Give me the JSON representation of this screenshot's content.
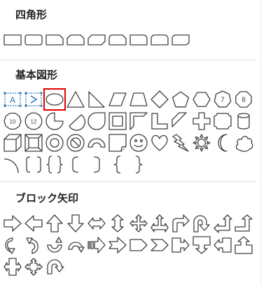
{
  "sections": [
    {
      "id": "rect",
      "title": "四角形",
      "shapes": [
        "rectangle",
        "rounded-rectangle",
        "snip-single-corner-rectangle",
        "snip-same-side-corner-rectangle",
        "snip-diagonal-corner-rectangle",
        "snip-round-single-corner-rectangle",
        "round-single-corner-rectangle",
        "round-same-side-corner-rectangle",
        "round-diagonal-corner-rectangle"
      ]
    },
    {
      "id": "basic",
      "title": "基本図形",
      "shapes": [
        "text-box",
        "vertical-text-box",
        "oval",
        "isosceles-triangle",
        "right-triangle",
        "parallelogram",
        "trapezoid",
        "diamond",
        "pentagon",
        "hexagon",
        "heptagon",
        "octagon",
        "decagon",
        "dodecagon",
        "pie",
        "chord",
        "teardrop",
        "frame",
        "half-frame",
        "l-shape",
        "diagonal-stripe",
        "cross",
        "plaque",
        "can",
        "cube",
        "bevel",
        "donut",
        "no-symbol",
        "block-arc",
        "folded-corner",
        "smiley-face",
        "heart",
        "lightning-bolt",
        "sun",
        "moon",
        "cloud",
        "arc",
        "double-bracket",
        "double-brace",
        "left-bracket",
        "right-bracket",
        "left-brace",
        "right-brace"
      ],
      "labels": {
        "text-box": "A",
        "vertical-text-box": "A",
        "heptagon": "7",
        "octagon": "8",
        "decagon": "10",
        "dodecagon": "12"
      },
      "selected": "oval"
    },
    {
      "id": "arrows",
      "title": "ブロック矢印",
      "shapes": [
        "right-arrow",
        "left-arrow",
        "up-arrow",
        "down-arrow",
        "left-right-arrow",
        "up-down-arrow",
        "quad-arrow",
        "left-right-up-arrow",
        "bent-arrow",
        "u-turn-arrow",
        "left-up-arrow",
        "bent-up-arrow",
        "curved-right-arrow",
        "curved-left-arrow",
        "curved-up-arrow",
        "curved-down-arrow",
        "striped-right-arrow",
        "notched-right-arrow",
        "pentagon-arrow",
        "chevron",
        "right-arrow-callout",
        "down-arrow-callout",
        "left-arrow-callout",
        "up-arrow-callout",
        "left-right-arrow-callout",
        "quad-arrow-callout",
        "circular-arrow"
      ]
    }
  ],
  "colors": {
    "stroke": "#404040",
    "selection": "#e00000",
    "textbox": "#2e75b6"
  }
}
